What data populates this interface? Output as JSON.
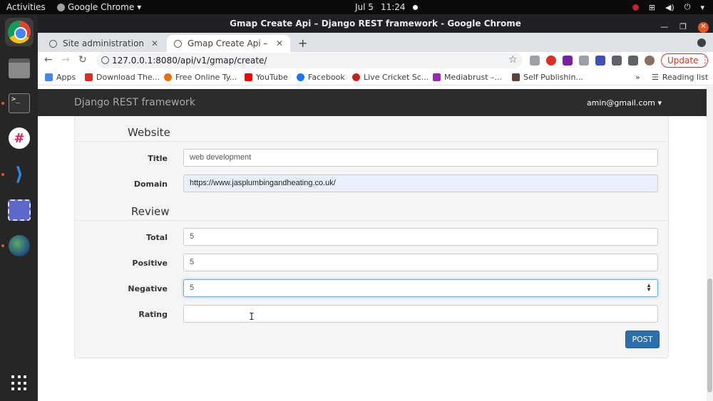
{
  "topbar": {
    "activities": "Activities",
    "app_menu": "Google Chrome",
    "date": "Jul 5",
    "time": "11:24"
  },
  "window": {
    "title": "Gmap Create Api – Django REST framework - Google Chrome"
  },
  "tabs": [
    {
      "label": "Site administration | Djan"
    },
    {
      "label": "Gmap Create Api – Djang"
    }
  ],
  "toolbar": {
    "url": "127.0.0.1:8080/api/v1/gmap/create/",
    "update_label": "Update"
  },
  "bookmarks": [
    {
      "label": "Apps",
      "color": "#4285f4"
    },
    {
      "label": "Download The...",
      "color": "#d93025"
    },
    {
      "label": "Free Online Ty...",
      "color": "#e8710a"
    },
    {
      "label": "YouTube",
      "color": "#ff0000"
    },
    {
      "label": "Facebook",
      "color": "#1877f2"
    },
    {
      "label": "Live Cricket Sc...",
      "color": "#c5221f"
    },
    {
      "label": "Mediabrust –...",
      "color": "#9c27b0"
    },
    {
      "label": "Self Publishin...",
      "color": "#5d4037"
    }
  ],
  "bookmarks_reading_list": "Reading list",
  "navbar": {
    "brand": "Django REST framework",
    "user": "amin@gmail.com"
  },
  "form": {
    "website_legend": "Website",
    "title_label": "Title",
    "title_value": "web development",
    "domain_label": "Domain",
    "domain_value": "https://www.jasplumbingandheating.co.uk/",
    "review_legend": "Review",
    "total_label": "Total",
    "total_value": "5",
    "positive_label": "Positive",
    "positive_value": "5",
    "negative_label": "Negative",
    "negative_value": "5",
    "rating_label": "Rating",
    "rating_value": "",
    "post_label": "POST"
  }
}
